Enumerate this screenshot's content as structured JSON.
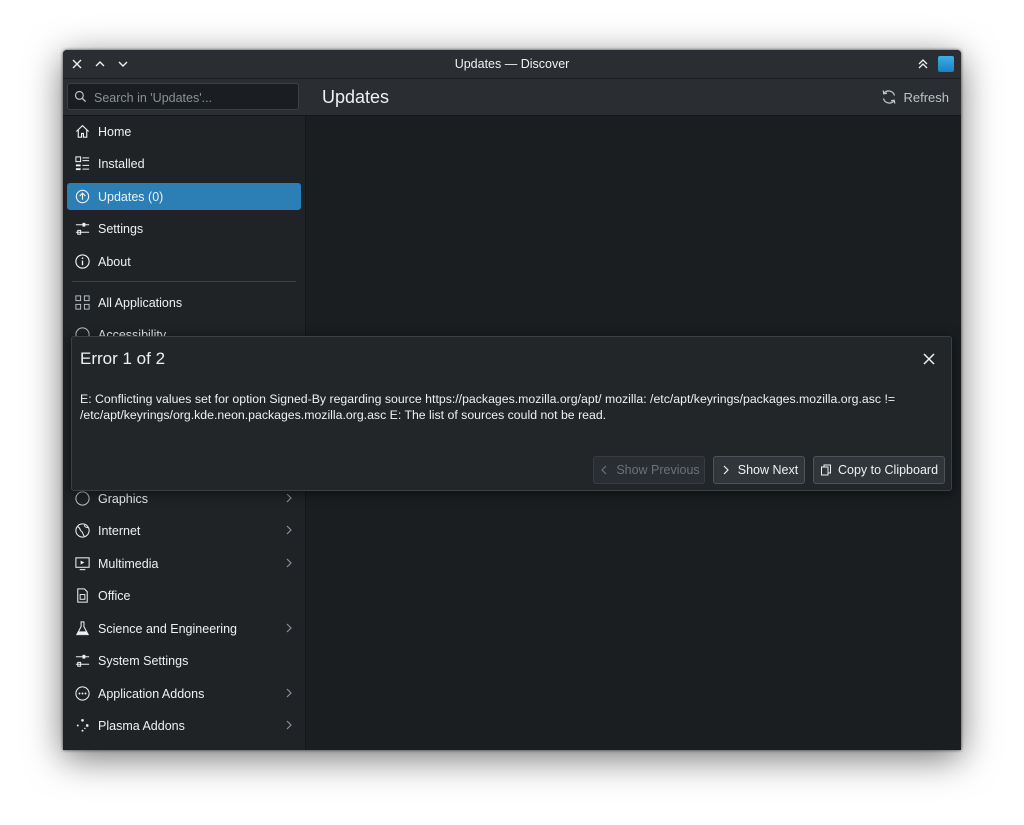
{
  "window": {
    "title": "Updates — Discover"
  },
  "search": {
    "placeholder": "Search in 'Updates'..."
  },
  "page": {
    "title": "Updates",
    "refresh_label": "Refresh"
  },
  "sidebar": {
    "items": [
      {
        "label": "Home",
        "icon": "home-icon"
      },
      {
        "label": "Installed",
        "icon": "installed-icon"
      },
      {
        "label": "Updates (0)",
        "icon": "updates-icon",
        "selected": true
      },
      {
        "label": "Settings",
        "icon": "settings-icon"
      },
      {
        "label": "About",
        "icon": "info-icon"
      }
    ],
    "categories": [
      {
        "label": "All Applications",
        "icon": "grid-icon"
      },
      {
        "label": "Accessibility",
        "icon": "accessibility-icon"
      },
      {
        "label": "Graphics",
        "icon": "graphics-icon",
        "has_children": true
      },
      {
        "label": "Internet",
        "icon": "globe-icon",
        "has_children": true
      },
      {
        "label": "Multimedia",
        "icon": "multimedia-icon",
        "has_children": true
      },
      {
        "label": "Office",
        "icon": "office-icon"
      },
      {
        "label": "Science and Engineering",
        "icon": "flask-icon",
        "has_children": true
      },
      {
        "label": "System Settings",
        "icon": "settings-icon"
      },
      {
        "label": "Application Addons",
        "icon": "addons-icon",
        "has_children": true
      },
      {
        "label": "Plasma Addons",
        "icon": "plasma-icon",
        "has_children": true
      }
    ]
  },
  "dialog": {
    "title": "Error 1 of 2",
    "message": "E: Conflicting values set for option Signed-By regarding source https://packages.mozilla.org/apt/ mozilla: /etc/apt/keyrings/packages.mozilla.org.asc != /etc/apt/keyrings/org.kde.neon.packages.mozilla.org.asc E: The list of sources could not be read.",
    "buttons": {
      "previous": "Show Previous",
      "next": "Show Next",
      "copy": "Copy to Clipboard"
    }
  },
  "colors": {
    "accent": "#3daee9",
    "selected": "#2c7fb5",
    "background": "#1b1e20",
    "text": "#eff0f1"
  }
}
